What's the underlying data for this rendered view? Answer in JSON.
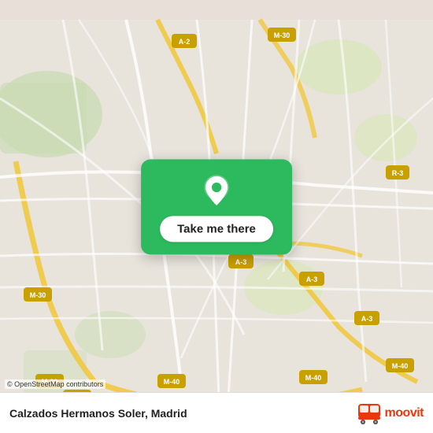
{
  "map": {
    "attribution": "© OpenStreetMap contributors"
  },
  "card": {
    "button_label": "Take me there",
    "pin_icon": "location-pin"
  },
  "bottom_bar": {
    "location_name": "Calzados Hermanos Soler, Madrid",
    "brand_name": "moovit"
  }
}
